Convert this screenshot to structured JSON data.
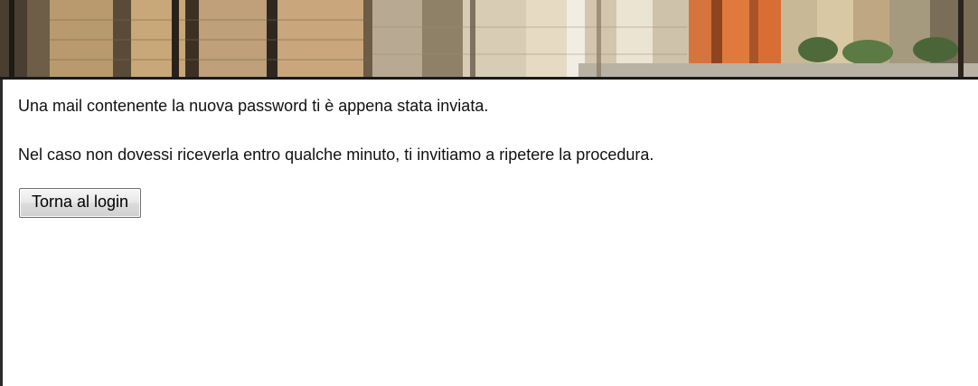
{
  "banner": {
    "description": ""
  },
  "messages": {
    "sent": "Una mail contenente la nuova password ti è appena stata inviata.",
    "retry": "Nel caso non dovessi riceverla entro qualche minuto, ti invitiamo a ripetere la procedura."
  },
  "actions": {
    "back_to_login": "Torna al login"
  }
}
